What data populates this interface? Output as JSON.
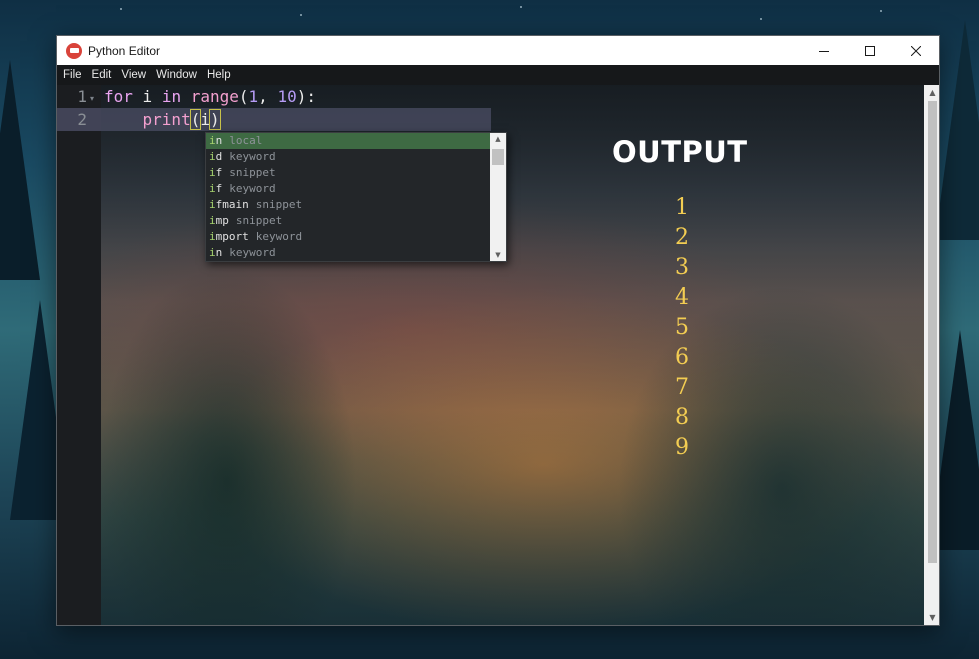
{
  "window": {
    "title": "Python Editor",
    "controls": [
      "minimize-icon",
      "maximize-icon",
      "close-icon"
    ]
  },
  "menu": {
    "items": [
      "File",
      "Edit",
      "View",
      "Window",
      "Help"
    ]
  },
  "editor": {
    "line_numbers": [
      "1",
      "2"
    ],
    "line1": {
      "kw_for": "for",
      "var_i": " i ",
      "kw_in": "in",
      "space": " ",
      "fn_range": "range",
      "open": "(",
      "num_1": "1",
      "comma": ", ",
      "num_10": "10",
      "close": "):"
    },
    "line2": {
      "indent": "    ",
      "fn_print": "print",
      "open": "(",
      "arg": "i",
      "close": ")"
    }
  },
  "autocomplete": {
    "items": [
      {
        "match": "i",
        "rest": "n",
        "kind": "local"
      },
      {
        "match": "i",
        "rest": "d",
        "kind": "keyword"
      },
      {
        "match": "i",
        "rest": "f",
        "kind": "snippet"
      },
      {
        "match": "i",
        "rest": "f",
        "kind": "keyword"
      },
      {
        "match": "i",
        "rest": "fmain",
        "kind": "snippet"
      },
      {
        "match": "i",
        "rest": "mp",
        "kind": "snippet"
      },
      {
        "match": "i",
        "rest": "mport",
        "kind": "keyword"
      },
      {
        "match": "i",
        "rest": "n",
        "kind": "keyword"
      }
    ],
    "selected_index": 0
  },
  "output": {
    "title": "OUTPUT",
    "lines": [
      "1",
      "2",
      "3",
      "4",
      "5",
      "6",
      "7",
      "8",
      "9"
    ]
  },
  "colors": {
    "keyword": "#e9a4f0",
    "function": "#f3a0cf",
    "number": "#b69cf5",
    "output_numbers": "#f3cd52",
    "selected_completion": "#3e6a43"
  }
}
